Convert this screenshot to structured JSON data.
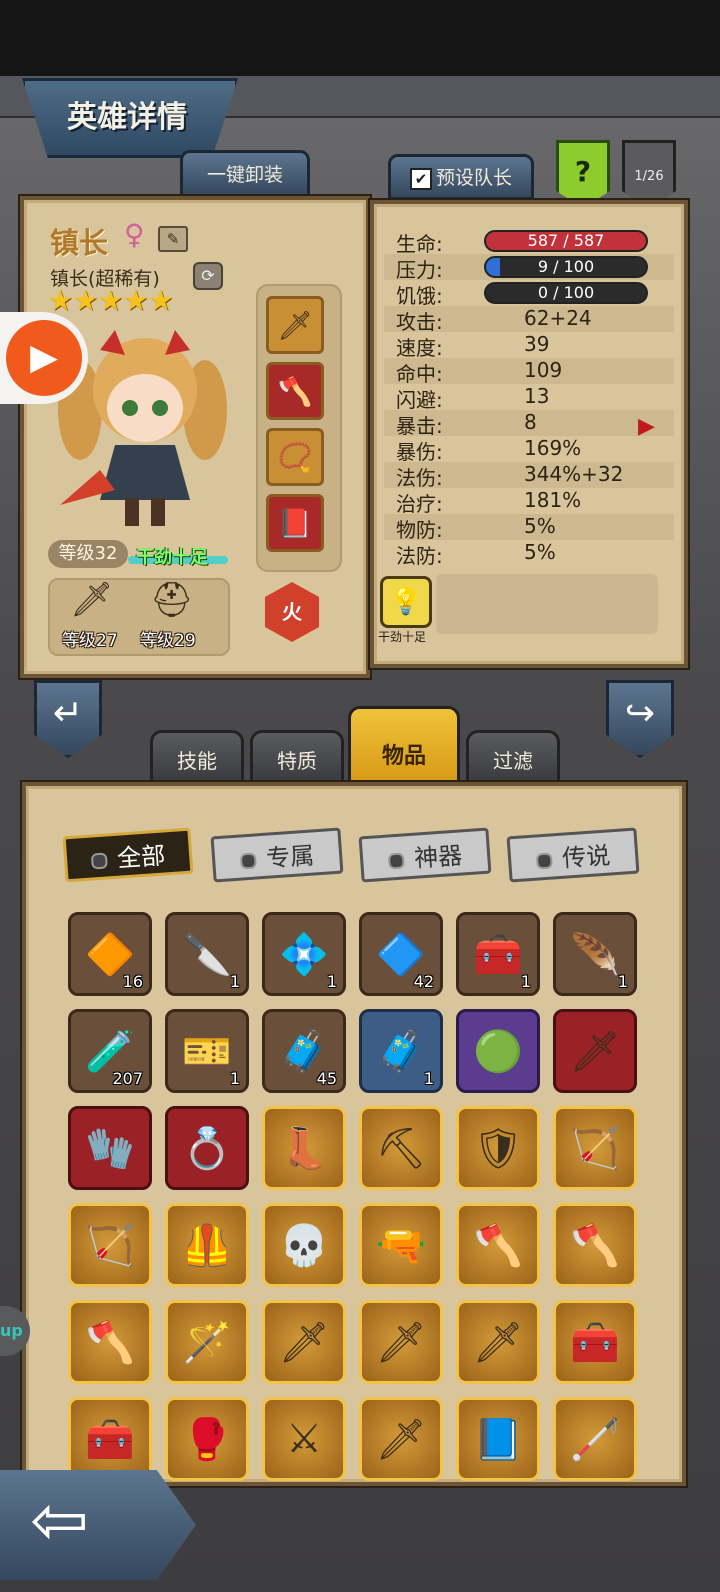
{
  "header": {
    "title": "英雄详情"
  },
  "top_buttons": {
    "unequip_all": "一键卸装",
    "preset_leader": "预设队长",
    "help": "?",
    "page_counter": "1/26"
  },
  "hero": {
    "name": "镇长",
    "gender_symbol": "♀",
    "subtitle": "镇长(超稀有)",
    "stars": 5,
    "level": "等级32",
    "mood": "干劲十足",
    "weapon_level": "等级27",
    "armor_level": "等级29",
    "element": "火",
    "trait_label": "干劲十足"
  },
  "stats": [
    {
      "label": "生命:",
      "value": "587 / 587",
      "type": "bar",
      "fill": 1.0,
      "color": "#c2323a"
    },
    {
      "label": "压力:",
      "value": "9 / 100",
      "type": "bar",
      "fill": 0.09,
      "color": "#2f6fd6"
    },
    {
      "label": "饥饿:",
      "value": "0 / 100",
      "type": "bar",
      "fill": 0.0,
      "color": "#d08a30"
    },
    {
      "label": "攻击:",
      "value": "62+24"
    },
    {
      "label": "速度:",
      "value": "39"
    },
    {
      "label": "命中:",
      "value": "109"
    },
    {
      "label": "闪避:",
      "value": "13"
    },
    {
      "label": "暴击:",
      "value": "8"
    },
    {
      "label": "暴伤:",
      "value": "169%"
    },
    {
      "label": "法伤:",
      "value": "344%+32"
    },
    {
      "label": "治疗:",
      "value": "181%"
    },
    {
      "label": "物防:",
      "value": "5%"
    },
    {
      "label": "法防:",
      "value": "5%"
    }
  ],
  "inventory_tabs": [
    "技能",
    "特质",
    "物品",
    "过滤"
  ],
  "active_tab": "物品",
  "filters": [
    "全部",
    "专属",
    "神器",
    "传说"
  ],
  "active_filter": "全部",
  "items": [
    {
      "icon": "orange-rune-gem-icon",
      "glyph": "🔶",
      "rarity": "brown",
      "count": "16"
    },
    {
      "icon": "chisel-knife-icon",
      "glyph": "🔪",
      "rarity": "brown",
      "count": "1"
    },
    {
      "icon": "blue-crystal-pile-icon",
      "glyph": "💠",
      "rarity": "brown",
      "count": "1"
    },
    {
      "icon": "cyan-rune-stone-icon",
      "glyph": "🔷",
      "rarity": "brown",
      "count": "42"
    },
    {
      "icon": "green-treasure-chest-icon",
      "glyph": "🧰",
      "rarity": "brown",
      "count": "1"
    },
    {
      "icon": "golden-feather-icon",
      "glyph": "🪶",
      "rarity": "brown",
      "count": "1"
    },
    {
      "icon": "blue-potion-icon",
      "glyph": "🧪",
      "rarity": "brown",
      "count": "207"
    },
    {
      "icon": "gold-tickets-icon",
      "glyph": "🎫",
      "rarity": "brown",
      "count": "1"
    },
    {
      "icon": "wooden-chest-icon",
      "glyph": "🧳",
      "rarity": "brown",
      "count": "45"
    },
    {
      "icon": "blue-chest-icon",
      "glyph": "🧳",
      "rarity": "blue",
      "count": "1"
    },
    {
      "icon": "green-orb-icon",
      "glyph": "🟢",
      "rarity": "purple",
      "count": ""
    },
    {
      "icon": "crystal-sword-icon",
      "glyph": "🗡",
      "rarity": "red",
      "count": ""
    },
    {
      "icon": "golden-gauntlet-icon",
      "glyph": "🧤",
      "rarity": "red",
      "count": ""
    },
    {
      "icon": "jeweled-ring-icon",
      "glyph": "💍",
      "rarity": "red",
      "count": ""
    },
    {
      "icon": "shadow-boots-icon",
      "glyph": "👢",
      "rarity": "gold",
      "count": ""
    },
    {
      "icon": "pickaxe-icon",
      "glyph": "⛏",
      "rarity": "gold",
      "count": ""
    },
    {
      "icon": "ornate-shield-icon",
      "glyph": "🛡",
      "rarity": "gold",
      "count": ""
    },
    {
      "icon": "crossbow-icon",
      "glyph": "🏹",
      "rarity": "gold",
      "count": ""
    },
    {
      "icon": "dark-crossbow-icon",
      "glyph": "🏹",
      "rarity": "gold",
      "count": ""
    },
    {
      "icon": "armor-chestplate-icon",
      "glyph": "🦺",
      "rarity": "gold",
      "count": ""
    },
    {
      "icon": "skull-cloak-icon",
      "glyph": "💀",
      "rarity": "gold",
      "count": ""
    },
    {
      "icon": "rifle-icon",
      "glyph": "🔫",
      "rarity": "gold",
      "count": ""
    },
    {
      "icon": "battle-axe-icon",
      "glyph": "🪓",
      "rarity": "gold",
      "count": ""
    },
    {
      "icon": "battle-axe-icon",
      "glyph": "🪓",
      "rarity": "gold",
      "count": ""
    },
    {
      "icon": "battle-axe-icon",
      "glyph": "🪓",
      "rarity": "gold",
      "count": ""
    },
    {
      "icon": "blue-orb-staff-icon",
      "glyph": "🪄",
      "rarity": "gold",
      "count": ""
    },
    {
      "icon": "curved-blade-icon",
      "glyph": "🗡",
      "rarity": "gold",
      "count": ""
    },
    {
      "icon": "cleaver-sword-icon",
      "glyph": "🗡",
      "rarity": "gold",
      "count": ""
    },
    {
      "icon": "cleaver-sword-icon",
      "glyph": "🗡",
      "rarity": "gold",
      "count": ""
    },
    {
      "icon": "medkit-icon",
      "glyph": "🧰",
      "rarity": "gold",
      "count": ""
    },
    {
      "icon": "medkit-icon",
      "glyph": "🧰",
      "rarity": "gold",
      "count": ""
    },
    {
      "icon": "spiked-gauntlet-icon",
      "glyph": "🥊",
      "rarity": "gold",
      "count": ""
    },
    {
      "icon": "steel-sword-icon",
      "glyph": "⚔",
      "rarity": "gold",
      "count": ""
    },
    {
      "icon": "bloody-katana-icon",
      "glyph": "🗡",
      "rarity": "gold",
      "count": ""
    },
    {
      "icon": "rune-book-icon",
      "glyph": "📘",
      "rarity": "gold",
      "count": ""
    },
    {
      "icon": "black-staff-icon",
      "glyph": "🦯",
      "rarity": "gold",
      "count": ""
    }
  ],
  "side_partial_text": "up"
}
